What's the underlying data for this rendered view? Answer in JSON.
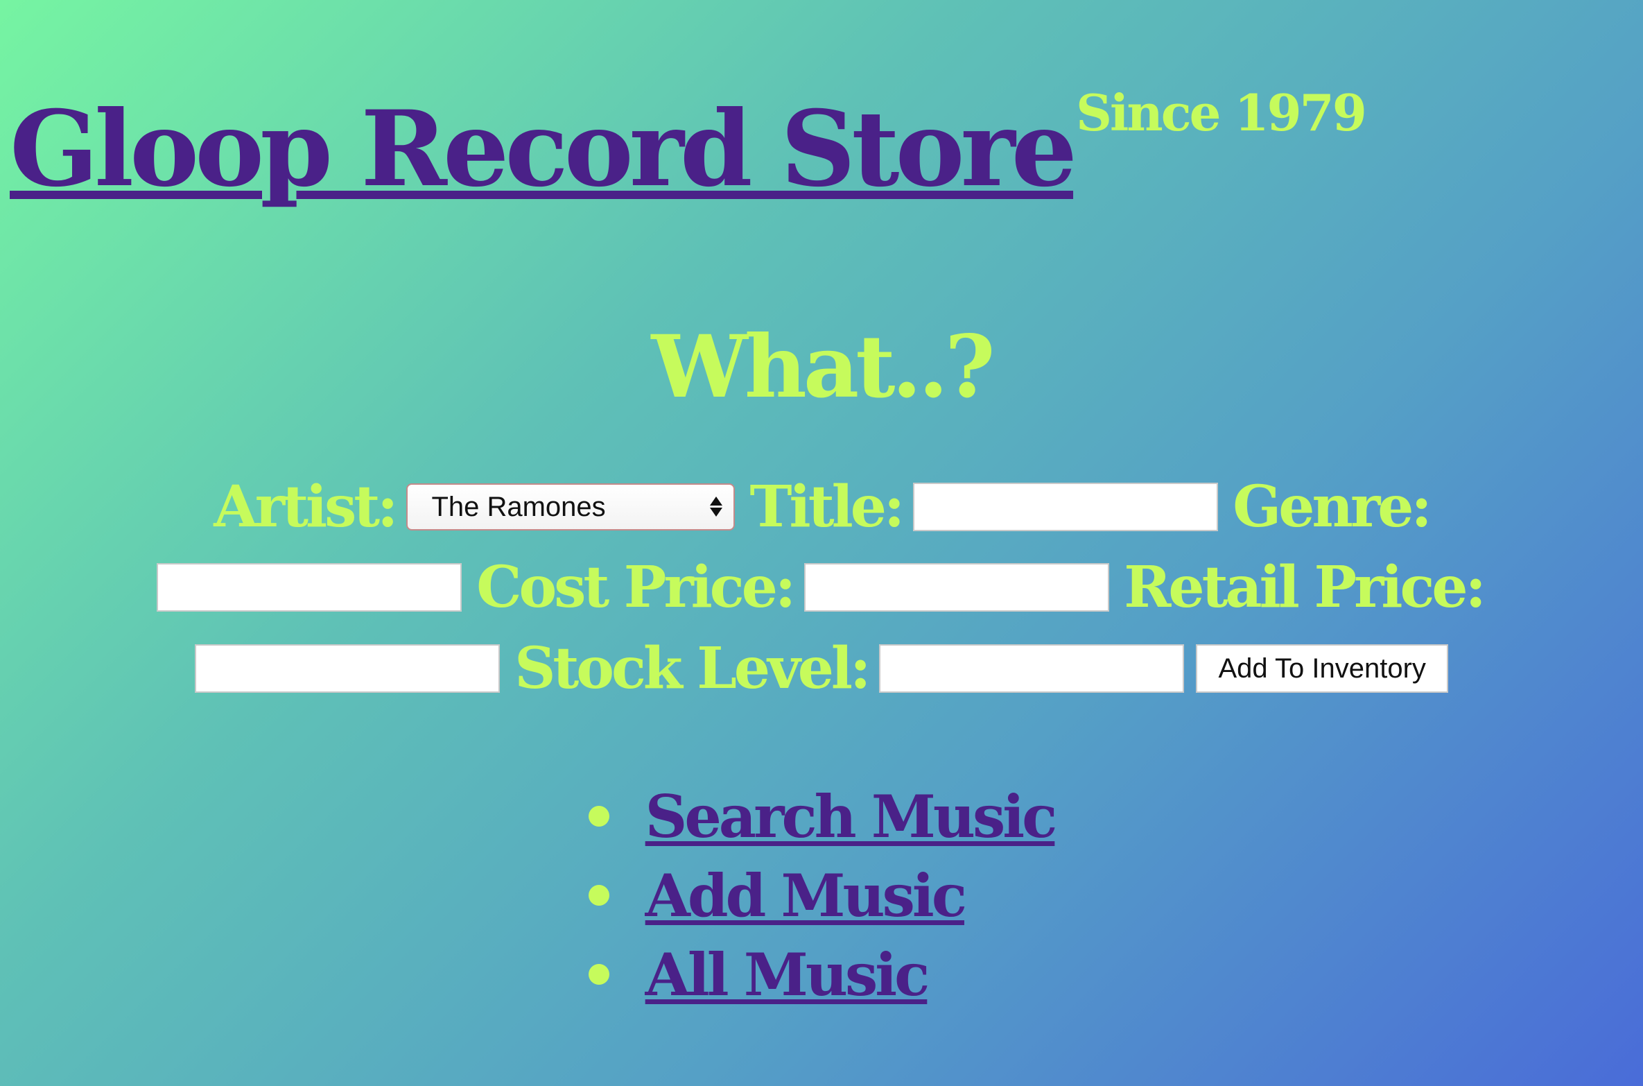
{
  "header": {
    "title": "Gloop Record Store",
    "since": "Since 1979"
  },
  "form": {
    "heading": "What..?",
    "artist_label": "Artist:",
    "artist_selected": "The Ramones",
    "title_label": "Title:",
    "title_value": "",
    "genre_label": "Genre:",
    "genre_value": "",
    "cost_price_label": "Cost Price:",
    "cost_price_value": "",
    "retail_price_label": "Retail Price:",
    "retail_price_value": "",
    "stock_level_label": "Stock Level:",
    "stock_level_value": "",
    "submit_label": "Add To Inventory"
  },
  "nav": {
    "items": [
      {
        "label": "Search Music"
      },
      {
        "label": "Add Music"
      },
      {
        "label": "All Music"
      }
    ]
  },
  "colors": {
    "title": "#4a2188",
    "accent": "#c6fb5c",
    "gradient_start": "#76f4a2",
    "gradient_end": "#4a6cd8"
  }
}
